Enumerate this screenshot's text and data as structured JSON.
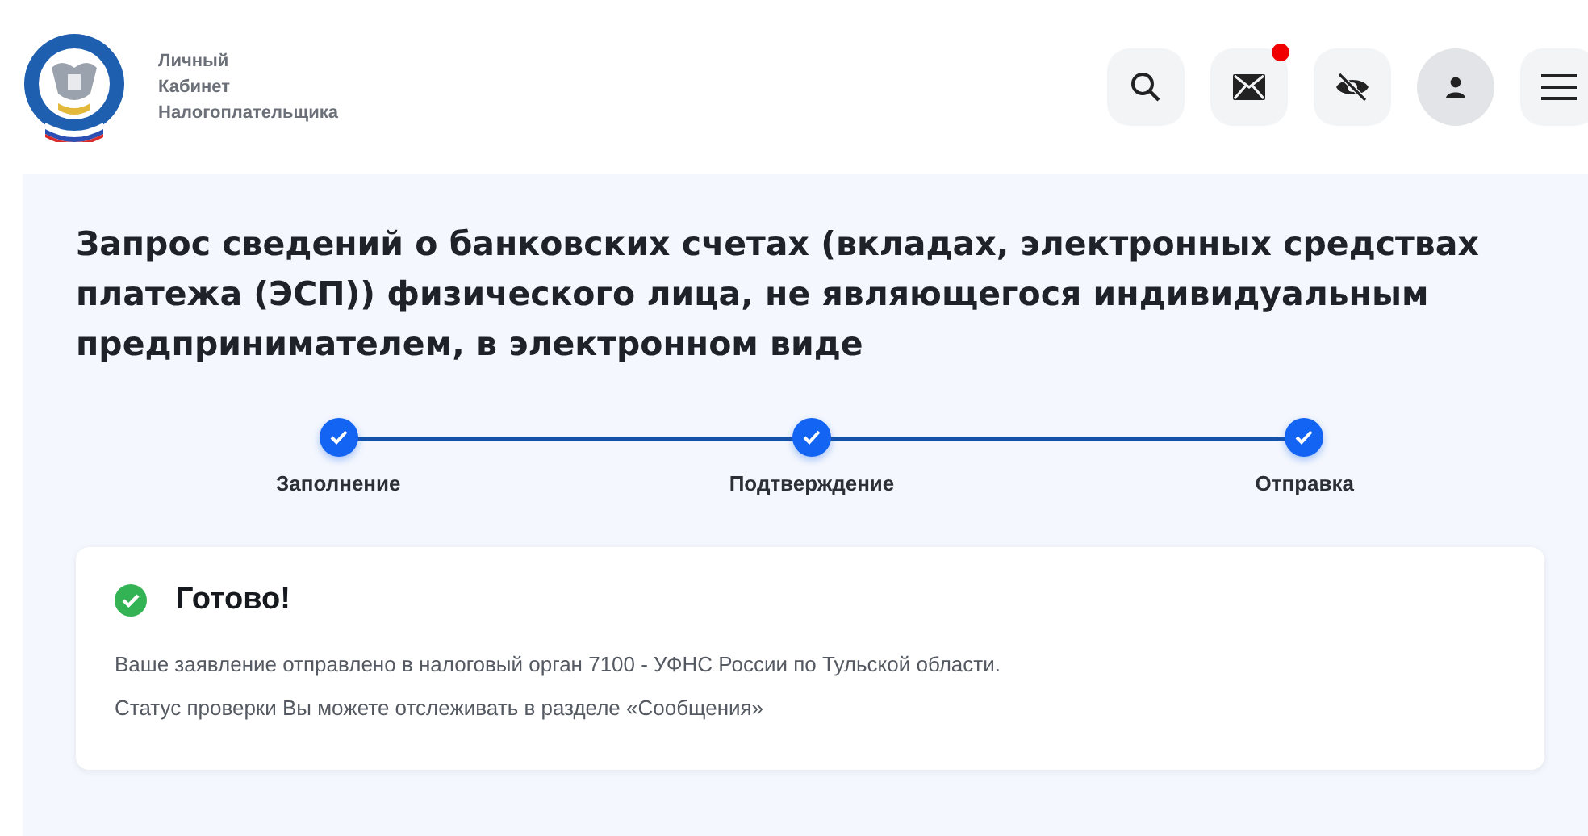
{
  "header": {
    "brand_lines": [
      "Личный",
      "Кабинет",
      "Налогоплательщика"
    ],
    "actions": [
      {
        "kind": "search",
        "badge": false
      },
      {
        "kind": "mail",
        "badge": true
      },
      {
        "kind": "eye",
        "badge": false
      },
      {
        "kind": "profile",
        "badge": false
      },
      {
        "kind": "menu",
        "badge": false
      }
    ]
  },
  "page": {
    "title": "Запрос сведений о банковских счетах (вкладах, электронных средствах платежа (ЭСП)) физического лица, не являющегося индивидуальным предпринимателем, в электронном виде",
    "steps": [
      {
        "label": "Заполнение",
        "done": true
      },
      {
        "label": "Подтверждение",
        "done": true
      },
      {
        "label": "Отправка",
        "done": true
      }
    ],
    "result": {
      "heading": "Готово!",
      "lines": [
        "Ваше заявление отправлено в налоговый орган 7100 - УФНС России по Тульской области.",
        "Статус проверки Вы можете отслеживать в разделе «Сообщения»"
      ]
    }
  }
}
